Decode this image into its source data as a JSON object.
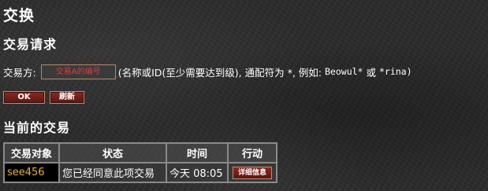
{
  "page": {
    "title": "交换"
  },
  "request": {
    "title": "交易请求",
    "partner_label": "交易方:",
    "partner_placeholder": "交易A的编号",
    "hint": "(名称或ID(至少需要达到级), 通配符为 *, 例如:",
    "example1": "Beowul*",
    "or": "或",
    "example2": "*rina)",
    "ok_label": "OK",
    "refresh_label": "刷新"
  },
  "current": {
    "title": "当前的交易",
    "columns": [
      "交易对象",
      "状态",
      "时间",
      "行动"
    ],
    "rows": [
      {
        "target": "see456",
        "status": "您已经同意此项交易",
        "time": "今天 08:05",
        "action": "详细信息"
      }
    ]
  },
  "colors": {
    "target_name": "#e5b23e",
    "button_red": "#8a2a20",
    "placeholder_red": "#d94040"
  }
}
